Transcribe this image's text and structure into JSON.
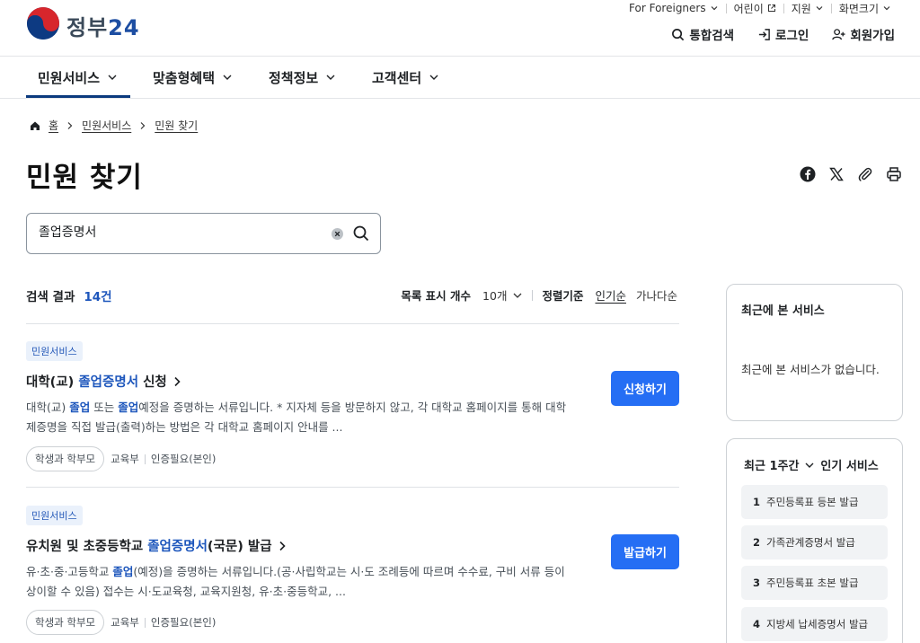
{
  "header": {
    "logo_text": "정부",
    "logo_num": "24",
    "utility": [
      {
        "label": "For Foreigners",
        "icon": "chevron-down-icon"
      },
      {
        "label": "어린이",
        "icon": "external-link-icon"
      },
      {
        "label": "지원",
        "icon": "chevron-down-icon"
      },
      {
        "label": "화면크기",
        "icon": "chevron-down-icon"
      }
    ],
    "account": [
      {
        "label": "통합검색",
        "icon": "search-icon"
      },
      {
        "label": "로그인",
        "icon": "login-icon"
      },
      {
        "label": "회원가입",
        "icon": "user-add-icon"
      }
    ]
  },
  "gnb": {
    "items": [
      {
        "label": "민원서비스",
        "active": true
      },
      {
        "label": "맞춤형혜택",
        "active": false
      },
      {
        "label": "정책정보",
        "active": false
      },
      {
        "label": "고객센터",
        "active": false
      }
    ]
  },
  "breadcrumb": {
    "home": "홈",
    "items": [
      "민원서비스",
      "민원 찾기"
    ]
  },
  "page": {
    "title": "민원 찾기",
    "share_icons": [
      "facebook-icon",
      "x-icon",
      "link-icon",
      "print-icon"
    ]
  },
  "search": {
    "value": "졸업증명서",
    "placeholder": ""
  },
  "results": {
    "label": "검색 결과",
    "count": "14건",
    "list_count_label": "목록 표시 개수",
    "list_count_value": "10개",
    "sort_label": "정렬기준",
    "sort_options": [
      "인기순",
      "가나다순"
    ],
    "sort_selected": "인기순",
    "items": [
      {
        "category": "민원서비스",
        "title_pre": "대학(교) ",
        "title_hl": "졸업증명서",
        "title_post": " 신청",
        "desc_parts": [
          "대학(교) ",
          "졸업",
          " 또는 ",
          "졸업",
          "예정을 증명하는 서류입니다. * 지자체 등을 방문하지 않고, 각 대학교 홈페이지를 통해 대학 제증명을 직접 발급(출력)하는 방법은 각 대학교 홈페이지 안내를 ..."
        ],
        "chip": "학생과 학부모",
        "org": "교육부",
        "auth": "인증필요(본인)",
        "button": "신청하기"
      },
      {
        "category": "민원서비스",
        "title_pre": "유치원 및 초중등학교 ",
        "title_hl": "졸업증명서",
        "title_post": "(국문) 발급",
        "desc_parts": [
          "유·초·중·고등학교 ",
          "졸업",
          "(예정)을 증명하는 서류입니다.(공·사립학교는 시·도 조례등에 따르며 수수료, 구비 서류 등이 상이할 수 있음) 접수는 시·도교육청, 교육지원청, 유·초·중등학교, ..."
        ],
        "chip": "학생과 학부모",
        "org": "교육부",
        "auth": "인증필요(본인)",
        "button": "발급하기"
      }
    ]
  },
  "recent_panel": {
    "title": "최근에 본 서비스",
    "empty": "최근에 본 서비스가 없습니다."
  },
  "popular_panel": {
    "period": "최근 1주간",
    "title": "인기 서비스",
    "items": [
      {
        "rank": "1",
        "label": "주민등록표 등본 발급"
      },
      {
        "rank": "2",
        "label": "가족관계증명서 발급"
      },
      {
        "rank": "3",
        "label": "주민등록표 초본 발급"
      },
      {
        "rank": "4",
        "label": "지방세 납세증명서 발급"
      }
    ]
  },
  "colors": {
    "primary_button": "#256ef4",
    "highlight": "#1d56bc",
    "nav_active": "#0b3a7e"
  }
}
